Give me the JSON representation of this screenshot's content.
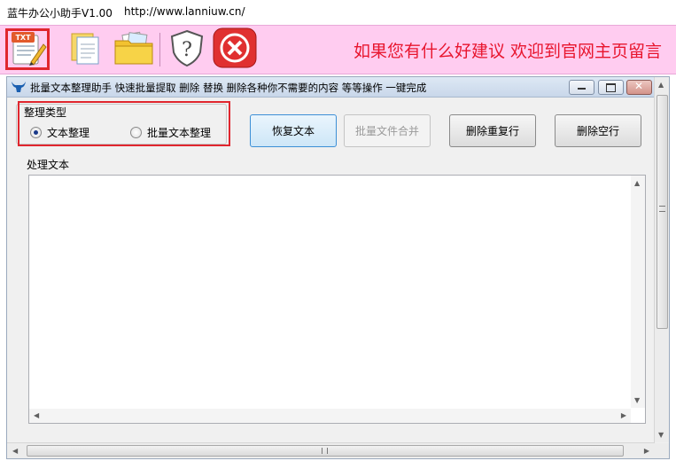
{
  "app": {
    "title": "蓝牛办公小助手V1.00",
    "url": "http://www.lanniuw.cn/"
  },
  "toolbar": {
    "buttons": [
      {
        "name": "txt-tool-icon"
      },
      {
        "name": "document-icon"
      },
      {
        "name": "folder-icon"
      },
      {
        "name": "help-shield-icon"
      },
      {
        "name": "close-circle-icon"
      }
    ],
    "slogan": "如果您有什么好建议 欢迎到官网主页留言"
  },
  "inner_window": {
    "title": "批量文本整理助手   快速批量提取 删除 替换 删除各种你不需要的内容 等等操作 一键完成"
  },
  "group": {
    "label": "整理类型",
    "options": [
      {
        "label": "文本整理",
        "selected": true
      },
      {
        "label": "批量文本整理",
        "selected": false
      }
    ]
  },
  "buttons": {
    "restore": "恢复文本",
    "merge": "批量文件合并",
    "delete_duplicate": "删除重复行",
    "delete_empty": "删除空行"
  },
  "text_area": {
    "label": "处理文本",
    "content": ""
  },
  "colors": {
    "toolbar_bg": "#ffccf0",
    "slogan": "#e8152e",
    "highlight": "#e0262e"
  }
}
